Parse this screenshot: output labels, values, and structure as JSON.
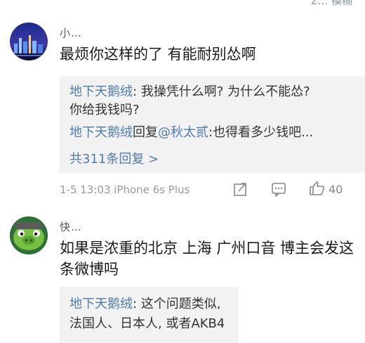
{
  "top_partial": "2… 模糊",
  "comments": [
    {
      "username": "小…",
      "text": "最烦你这样的了 有能耐别怂啊",
      "replies": [
        {
          "name": "地下天鹅绒",
          "sep": ": ",
          "body": "我操凭什么啊? 为什么不能怂?",
          "body2": "你给我钱吗?"
        },
        {
          "name": "地下天鹅绒",
          "sep": "回复",
          "mention": "@秋太贰",
          "body": ":也得看多少钱吧..."
        }
      ],
      "reply_count": "共311条回复 >",
      "meta": "1-5 13:03  iPhone 6s Plus",
      "likes": "40"
    },
    {
      "username": "快…",
      "text": "如果是浓重的北京 上海 广州口音 博主会发这",
      "text2": "条微博吗",
      "replies": [
        {
          "name": "地下天鹅绒",
          "sep": ": ",
          "body": "这个问题类似,",
          "body2": "法国人、日本人, 或者AKB4"
        }
      ]
    }
  ],
  "colors": {
    "link": "#4f7cad",
    "reply_bg": "#f2f2f2",
    "meta": "#999999"
  },
  "icons": [
    "share-icon",
    "comment-icon",
    "like-icon"
  ]
}
